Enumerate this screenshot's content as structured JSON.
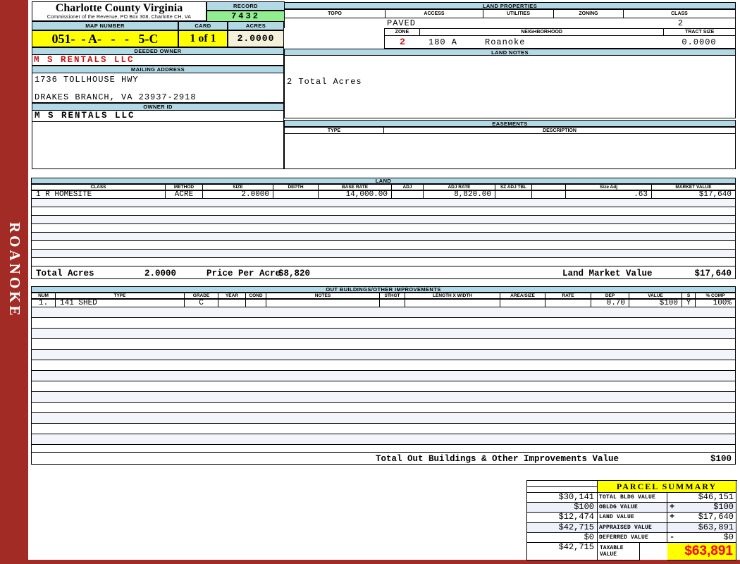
{
  "brand": {
    "sidebar_text": "ROANOKE",
    "title": "Charlotte County Virginia",
    "subtitle": "Commissioner of the Revenue, PO Box 308, Charlotte CH, VA"
  },
  "record": {
    "label": "RECORD",
    "value": "7432"
  },
  "map": {
    "label": "MAP NUMBER",
    "value": "051-  - A-   -   -   5-C"
  },
  "card": {
    "label": "CARD",
    "value": "1 of 1"
  },
  "acres": {
    "label": "ACRES",
    "value": "2.0000"
  },
  "owner": {
    "deeded_label": "DEEDED OWNER",
    "deeded": "M S RENTALS LLC",
    "mailing_label": "MAILING ADDRESS",
    "address1": "1736 TOLLHOUSE HWY",
    "address2": "DRAKES BRANCH, VA 23937-2918",
    "id_label": "OWNER ID",
    "id": "M S RENTALS LLC"
  },
  "land_properties": {
    "title": "LAND PROPERTIES",
    "headers": [
      "TOPO",
      "ACCESS",
      "UTILITIES",
      "ZONING",
      "CLASS"
    ],
    "access_value": "PAVED",
    "class_value": "2",
    "zone_label": "ZONE",
    "zone_value": "2",
    "neighborhood_label": "NEIGHBORHOOD",
    "neighborhood_code": "180 A",
    "neighborhood_name": "Roanoke",
    "tract_label": "TRACT SIZE",
    "tract_value": "0.0000"
  },
  "land_notes": {
    "title": "LAND NOTES",
    "note": "2 Total Acres"
  },
  "easements": {
    "title": "EASEMENTS",
    "type_label": "TYPE",
    "desc_label": "DESCRIPTION"
  },
  "land": {
    "title": "LAND",
    "headers": [
      "CLASS",
      "METHOD",
      "SIZE",
      "DEPTH",
      "BASE RATE",
      "ADJ",
      "ADJ RATE",
      "SZ ADJ TBL",
      "",
      "Size Adj",
      "MARKET VALUE"
    ],
    "row": {
      "class": "1 R HOMESITE",
      "method": "ACRE",
      "size": "2.0000",
      "depth": "",
      "base_rate": "14,000.00",
      "adj": "",
      "adj_rate": "8,820.00",
      "sz_adj_tbl": "",
      "blank": "",
      "size_adj": ".63",
      "market_value": "$17,640"
    },
    "totals": {
      "total_acres_label": "Total Acres",
      "total_acres": "2.0000",
      "price_per_acre_label": "Price Per Acre",
      "price_per_acre": "$8,820",
      "market_label": "Land Market Value",
      "market_value": "$17,640"
    }
  },
  "outbuildings": {
    "title": "OUT BUILDINGS/OTHER IMPROVEMENTS",
    "headers": [
      "NUM",
      "TYPE",
      "GRADE",
      "YEAR",
      "COND",
      "NOTES",
      "STHGT",
      "LENGTH X WIDTH",
      "AREA/SIZE",
      "RATE",
      "DEP",
      "VALUE",
      "S",
      "% COMP"
    ],
    "row": {
      "num": "1.",
      "type": "141 SHED",
      "grade": "C",
      "year": "",
      "cond": "",
      "notes": "",
      "sthgt": "",
      "length_x_width": "",
      "area_size": "",
      "rate": "",
      "dep": "0.70",
      "value": "$100",
      "s": "Y",
      "comp": "100%"
    },
    "total_label": "Total Out Buildings & Other Improvements Value",
    "total_value": "$100"
  },
  "parcel_summary": {
    "title": "PARCEL SUMMARY",
    "rows": [
      {
        "prior": "$30,141",
        "label": "TOTAL BLDG VALUE",
        "op": "",
        "value": "$46,151"
      },
      {
        "prior": "$100",
        "label": "OBLDG VALUE",
        "op": "+",
        "value": "$100"
      },
      {
        "prior": "$12,474",
        "label": "LAND VALUE",
        "op": "+",
        "value": "$17,640"
      },
      {
        "prior": "$42,715",
        "label": "APPRAISED VALUE",
        "op": "",
        "value": "$63,891"
      },
      {
        "prior": "$0",
        "label": "DEFERRED VALUE",
        "op": "-",
        "value": "$0"
      },
      {
        "prior": "$42,715",
        "label": "TAXABLE VALUE",
        "op": "",
        "value": "$63,891"
      }
    ]
  },
  "colors": {
    "header_blue": "#b3d9e6",
    "record_green": "#90ee90",
    "highlight_yellow": "#ffff00",
    "acres_cream": "#f5f0da",
    "sidebar_red": "#a32b26",
    "owner_red": "#cc1111",
    "taxable_red": "#ff0000",
    "stripe_lavender": "#f4f4fb"
  }
}
